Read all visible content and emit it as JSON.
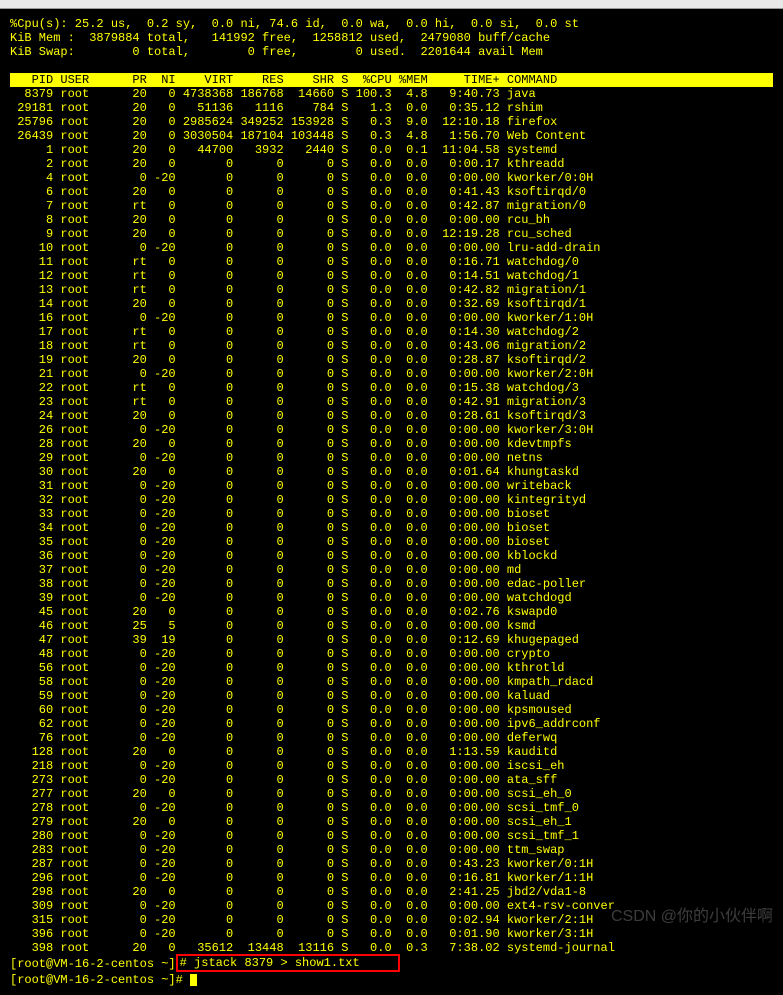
{
  "cpu_line": "%Cpu(s): 25.2 us,  0.2 sy,  0.0 ni, 74.6 id,  0.0 wa,  0.0 hi,  0.0 si,  0.0 st",
  "mem_line": "KiB Mem :  3879884 total,   141992 free,  1258812 used,  2479080 buff/cache",
  "swap_line": "KiB Swap:        0 total,        0 free,        0 used.  2201644 avail Mem",
  "header": "   PID USER      PR  NI    VIRT    RES    SHR S  %CPU %MEM     TIME+ COMMAND            ",
  "processes": [
    {
      "pid": "8379",
      "user": "root",
      "pr": "20",
      "ni": "0",
      "virt": "4738368",
      "res": "186768",
      "shr": "14660",
      "s": "S",
      "cpu": "100.3",
      "mem": "4.8",
      "time": "9:40.73",
      "cmd": "java"
    },
    {
      "pid": "29181",
      "user": "root",
      "pr": "20",
      "ni": "0",
      "virt": "51136",
      "res": "1116",
      "shr": "784",
      "s": "S",
      "cpu": "1.3",
      "mem": "0.0",
      "time": "0:35.12",
      "cmd": "rshim"
    },
    {
      "pid": "25796",
      "user": "root",
      "pr": "20",
      "ni": "0",
      "virt": "2985624",
      "res": "349252",
      "shr": "153928",
      "s": "S",
      "cpu": "0.3",
      "mem": "9.0",
      "time": "12:10.18",
      "cmd": "firefox"
    },
    {
      "pid": "26439",
      "user": "root",
      "pr": "20",
      "ni": "0",
      "virt": "3030504",
      "res": "187104",
      "shr": "103448",
      "s": "S",
      "cpu": "0.3",
      "mem": "4.8",
      "time": "1:56.70",
      "cmd": "Web Content"
    },
    {
      "pid": "1",
      "user": "root",
      "pr": "20",
      "ni": "0",
      "virt": "44700",
      "res": "3932",
      "shr": "2440",
      "s": "S",
      "cpu": "0.0",
      "mem": "0.1",
      "time": "11:04.58",
      "cmd": "systemd"
    },
    {
      "pid": "2",
      "user": "root",
      "pr": "20",
      "ni": "0",
      "virt": "0",
      "res": "0",
      "shr": "0",
      "s": "S",
      "cpu": "0.0",
      "mem": "0.0",
      "time": "0:00.17",
      "cmd": "kthreadd"
    },
    {
      "pid": "4",
      "user": "root",
      "pr": "0",
      "ni": "-20",
      "virt": "0",
      "res": "0",
      "shr": "0",
      "s": "S",
      "cpu": "0.0",
      "mem": "0.0",
      "time": "0:00.00",
      "cmd": "kworker/0:0H"
    },
    {
      "pid": "6",
      "user": "root",
      "pr": "20",
      "ni": "0",
      "virt": "0",
      "res": "0",
      "shr": "0",
      "s": "S",
      "cpu": "0.0",
      "mem": "0.0",
      "time": "0:41.43",
      "cmd": "ksoftirqd/0"
    },
    {
      "pid": "7",
      "user": "root",
      "pr": "rt",
      "ni": "0",
      "virt": "0",
      "res": "0",
      "shr": "0",
      "s": "S",
      "cpu": "0.0",
      "mem": "0.0",
      "time": "0:42.87",
      "cmd": "migration/0"
    },
    {
      "pid": "8",
      "user": "root",
      "pr": "20",
      "ni": "0",
      "virt": "0",
      "res": "0",
      "shr": "0",
      "s": "S",
      "cpu": "0.0",
      "mem": "0.0",
      "time": "0:00.00",
      "cmd": "rcu_bh"
    },
    {
      "pid": "9",
      "user": "root",
      "pr": "20",
      "ni": "0",
      "virt": "0",
      "res": "0",
      "shr": "0",
      "s": "S",
      "cpu": "0.0",
      "mem": "0.0",
      "time": "12:19.28",
      "cmd": "rcu_sched"
    },
    {
      "pid": "10",
      "user": "root",
      "pr": "0",
      "ni": "-20",
      "virt": "0",
      "res": "0",
      "shr": "0",
      "s": "S",
      "cpu": "0.0",
      "mem": "0.0",
      "time": "0:00.00",
      "cmd": "lru-add-drain"
    },
    {
      "pid": "11",
      "user": "root",
      "pr": "rt",
      "ni": "0",
      "virt": "0",
      "res": "0",
      "shr": "0",
      "s": "S",
      "cpu": "0.0",
      "mem": "0.0",
      "time": "0:16.71",
      "cmd": "watchdog/0"
    },
    {
      "pid": "12",
      "user": "root",
      "pr": "rt",
      "ni": "0",
      "virt": "0",
      "res": "0",
      "shr": "0",
      "s": "S",
      "cpu": "0.0",
      "mem": "0.0",
      "time": "0:14.51",
      "cmd": "watchdog/1"
    },
    {
      "pid": "13",
      "user": "root",
      "pr": "rt",
      "ni": "0",
      "virt": "0",
      "res": "0",
      "shr": "0",
      "s": "S",
      "cpu": "0.0",
      "mem": "0.0",
      "time": "0:42.82",
      "cmd": "migration/1"
    },
    {
      "pid": "14",
      "user": "root",
      "pr": "20",
      "ni": "0",
      "virt": "0",
      "res": "0",
      "shr": "0",
      "s": "S",
      "cpu": "0.0",
      "mem": "0.0",
      "time": "0:32.69",
      "cmd": "ksoftirqd/1"
    },
    {
      "pid": "16",
      "user": "root",
      "pr": "0",
      "ni": "-20",
      "virt": "0",
      "res": "0",
      "shr": "0",
      "s": "S",
      "cpu": "0.0",
      "mem": "0.0",
      "time": "0:00.00",
      "cmd": "kworker/1:0H"
    },
    {
      "pid": "17",
      "user": "root",
      "pr": "rt",
      "ni": "0",
      "virt": "0",
      "res": "0",
      "shr": "0",
      "s": "S",
      "cpu": "0.0",
      "mem": "0.0",
      "time": "0:14.30",
      "cmd": "watchdog/2"
    },
    {
      "pid": "18",
      "user": "root",
      "pr": "rt",
      "ni": "0",
      "virt": "0",
      "res": "0",
      "shr": "0",
      "s": "S",
      "cpu": "0.0",
      "mem": "0.0",
      "time": "0:43.06",
      "cmd": "migration/2"
    },
    {
      "pid": "19",
      "user": "root",
      "pr": "20",
      "ni": "0",
      "virt": "0",
      "res": "0",
      "shr": "0",
      "s": "S",
      "cpu": "0.0",
      "mem": "0.0",
      "time": "0:28.87",
      "cmd": "ksoftirqd/2"
    },
    {
      "pid": "21",
      "user": "root",
      "pr": "0",
      "ni": "-20",
      "virt": "0",
      "res": "0",
      "shr": "0",
      "s": "S",
      "cpu": "0.0",
      "mem": "0.0",
      "time": "0:00.00",
      "cmd": "kworker/2:0H"
    },
    {
      "pid": "22",
      "user": "root",
      "pr": "rt",
      "ni": "0",
      "virt": "0",
      "res": "0",
      "shr": "0",
      "s": "S",
      "cpu": "0.0",
      "mem": "0.0",
      "time": "0:15.38",
      "cmd": "watchdog/3"
    },
    {
      "pid": "23",
      "user": "root",
      "pr": "rt",
      "ni": "0",
      "virt": "0",
      "res": "0",
      "shr": "0",
      "s": "S",
      "cpu": "0.0",
      "mem": "0.0",
      "time": "0:42.91",
      "cmd": "migration/3"
    },
    {
      "pid": "24",
      "user": "root",
      "pr": "20",
      "ni": "0",
      "virt": "0",
      "res": "0",
      "shr": "0",
      "s": "S",
      "cpu": "0.0",
      "mem": "0.0",
      "time": "0:28.61",
      "cmd": "ksoftirqd/3"
    },
    {
      "pid": "26",
      "user": "root",
      "pr": "0",
      "ni": "-20",
      "virt": "0",
      "res": "0",
      "shr": "0",
      "s": "S",
      "cpu": "0.0",
      "mem": "0.0",
      "time": "0:00.00",
      "cmd": "kworker/3:0H"
    },
    {
      "pid": "28",
      "user": "root",
      "pr": "20",
      "ni": "0",
      "virt": "0",
      "res": "0",
      "shr": "0",
      "s": "S",
      "cpu": "0.0",
      "mem": "0.0",
      "time": "0:00.00",
      "cmd": "kdevtmpfs"
    },
    {
      "pid": "29",
      "user": "root",
      "pr": "0",
      "ni": "-20",
      "virt": "0",
      "res": "0",
      "shr": "0",
      "s": "S",
      "cpu": "0.0",
      "mem": "0.0",
      "time": "0:00.00",
      "cmd": "netns"
    },
    {
      "pid": "30",
      "user": "root",
      "pr": "20",
      "ni": "0",
      "virt": "0",
      "res": "0",
      "shr": "0",
      "s": "S",
      "cpu": "0.0",
      "mem": "0.0",
      "time": "0:01.64",
      "cmd": "khungtaskd"
    },
    {
      "pid": "31",
      "user": "root",
      "pr": "0",
      "ni": "-20",
      "virt": "0",
      "res": "0",
      "shr": "0",
      "s": "S",
      "cpu": "0.0",
      "mem": "0.0",
      "time": "0:00.00",
      "cmd": "writeback"
    },
    {
      "pid": "32",
      "user": "root",
      "pr": "0",
      "ni": "-20",
      "virt": "0",
      "res": "0",
      "shr": "0",
      "s": "S",
      "cpu": "0.0",
      "mem": "0.0",
      "time": "0:00.00",
      "cmd": "kintegrityd"
    },
    {
      "pid": "33",
      "user": "root",
      "pr": "0",
      "ni": "-20",
      "virt": "0",
      "res": "0",
      "shr": "0",
      "s": "S",
      "cpu": "0.0",
      "mem": "0.0",
      "time": "0:00.00",
      "cmd": "bioset"
    },
    {
      "pid": "34",
      "user": "root",
      "pr": "0",
      "ni": "-20",
      "virt": "0",
      "res": "0",
      "shr": "0",
      "s": "S",
      "cpu": "0.0",
      "mem": "0.0",
      "time": "0:00.00",
      "cmd": "bioset"
    },
    {
      "pid": "35",
      "user": "root",
      "pr": "0",
      "ni": "-20",
      "virt": "0",
      "res": "0",
      "shr": "0",
      "s": "S",
      "cpu": "0.0",
      "mem": "0.0",
      "time": "0:00.00",
      "cmd": "bioset"
    },
    {
      "pid": "36",
      "user": "root",
      "pr": "0",
      "ni": "-20",
      "virt": "0",
      "res": "0",
      "shr": "0",
      "s": "S",
      "cpu": "0.0",
      "mem": "0.0",
      "time": "0:00.00",
      "cmd": "kblockd"
    },
    {
      "pid": "37",
      "user": "root",
      "pr": "0",
      "ni": "-20",
      "virt": "0",
      "res": "0",
      "shr": "0",
      "s": "S",
      "cpu": "0.0",
      "mem": "0.0",
      "time": "0:00.00",
      "cmd": "md"
    },
    {
      "pid": "38",
      "user": "root",
      "pr": "0",
      "ni": "-20",
      "virt": "0",
      "res": "0",
      "shr": "0",
      "s": "S",
      "cpu": "0.0",
      "mem": "0.0",
      "time": "0:00.00",
      "cmd": "edac-poller"
    },
    {
      "pid": "39",
      "user": "root",
      "pr": "0",
      "ni": "-20",
      "virt": "0",
      "res": "0",
      "shr": "0",
      "s": "S",
      "cpu": "0.0",
      "mem": "0.0",
      "time": "0:00.00",
      "cmd": "watchdogd"
    },
    {
      "pid": "45",
      "user": "root",
      "pr": "20",
      "ni": "0",
      "virt": "0",
      "res": "0",
      "shr": "0",
      "s": "S",
      "cpu": "0.0",
      "mem": "0.0",
      "time": "0:02.76",
      "cmd": "kswapd0"
    },
    {
      "pid": "46",
      "user": "root",
      "pr": "25",
      "ni": "5",
      "virt": "0",
      "res": "0",
      "shr": "0",
      "s": "S",
      "cpu": "0.0",
      "mem": "0.0",
      "time": "0:00.00",
      "cmd": "ksmd"
    },
    {
      "pid": "47",
      "user": "root",
      "pr": "39",
      "ni": "19",
      "virt": "0",
      "res": "0",
      "shr": "0",
      "s": "S",
      "cpu": "0.0",
      "mem": "0.0",
      "time": "0:12.69",
      "cmd": "khugepaged"
    },
    {
      "pid": "48",
      "user": "root",
      "pr": "0",
      "ni": "-20",
      "virt": "0",
      "res": "0",
      "shr": "0",
      "s": "S",
      "cpu": "0.0",
      "mem": "0.0",
      "time": "0:00.00",
      "cmd": "crypto"
    },
    {
      "pid": "56",
      "user": "root",
      "pr": "0",
      "ni": "-20",
      "virt": "0",
      "res": "0",
      "shr": "0",
      "s": "S",
      "cpu": "0.0",
      "mem": "0.0",
      "time": "0:00.00",
      "cmd": "kthrotld"
    },
    {
      "pid": "58",
      "user": "root",
      "pr": "0",
      "ni": "-20",
      "virt": "0",
      "res": "0",
      "shr": "0",
      "s": "S",
      "cpu": "0.0",
      "mem": "0.0",
      "time": "0:00.00",
      "cmd": "kmpath_rdacd"
    },
    {
      "pid": "59",
      "user": "root",
      "pr": "0",
      "ni": "-20",
      "virt": "0",
      "res": "0",
      "shr": "0",
      "s": "S",
      "cpu": "0.0",
      "mem": "0.0",
      "time": "0:00.00",
      "cmd": "kaluad"
    },
    {
      "pid": "60",
      "user": "root",
      "pr": "0",
      "ni": "-20",
      "virt": "0",
      "res": "0",
      "shr": "0",
      "s": "S",
      "cpu": "0.0",
      "mem": "0.0",
      "time": "0:00.00",
      "cmd": "kpsmoused"
    },
    {
      "pid": "62",
      "user": "root",
      "pr": "0",
      "ni": "-20",
      "virt": "0",
      "res": "0",
      "shr": "0",
      "s": "S",
      "cpu": "0.0",
      "mem": "0.0",
      "time": "0:00.00",
      "cmd": "ipv6_addrconf"
    },
    {
      "pid": "76",
      "user": "root",
      "pr": "0",
      "ni": "-20",
      "virt": "0",
      "res": "0",
      "shr": "0",
      "s": "S",
      "cpu": "0.0",
      "mem": "0.0",
      "time": "0:00.00",
      "cmd": "deferwq"
    },
    {
      "pid": "128",
      "user": "root",
      "pr": "20",
      "ni": "0",
      "virt": "0",
      "res": "0",
      "shr": "0",
      "s": "S",
      "cpu": "0.0",
      "mem": "0.0",
      "time": "1:13.59",
      "cmd": "kauditd"
    },
    {
      "pid": "218",
      "user": "root",
      "pr": "0",
      "ni": "-20",
      "virt": "0",
      "res": "0",
      "shr": "0",
      "s": "S",
      "cpu": "0.0",
      "mem": "0.0",
      "time": "0:00.00",
      "cmd": "iscsi_eh"
    },
    {
      "pid": "273",
      "user": "root",
      "pr": "0",
      "ni": "-20",
      "virt": "0",
      "res": "0",
      "shr": "0",
      "s": "S",
      "cpu": "0.0",
      "mem": "0.0",
      "time": "0:00.00",
      "cmd": "ata_sff"
    },
    {
      "pid": "277",
      "user": "root",
      "pr": "20",
      "ni": "0",
      "virt": "0",
      "res": "0",
      "shr": "0",
      "s": "S",
      "cpu": "0.0",
      "mem": "0.0",
      "time": "0:00.00",
      "cmd": "scsi_eh_0"
    },
    {
      "pid": "278",
      "user": "root",
      "pr": "0",
      "ni": "-20",
      "virt": "0",
      "res": "0",
      "shr": "0",
      "s": "S",
      "cpu": "0.0",
      "mem": "0.0",
      "time": "0:00.00",
      "cmd": "scsi_tmf_0"
    },
    {
      "pid": "279",
      "user": "root",
      "pr": "20",
      "ni": "0",
      "virt": "0",
      "res": "0",
      "shr": "0",
      "s": "S",
      "cpu": "0.0",
      "mem": "0.0",
      "time": "0:00.00",
      "cmd": "scsi_eh_1"
    },
    {
      "pid": "280",
      "user": "root",
      "pr": "0",
      "ni": "-20",
      "virt": "0",
      "res": "0",
      "shr": "0",
      "s": "S",
      "cpu": "0.0",
      "mem": "0.0",
      "time": "0:00.00",
      "cmd": "scsi_tmf_1"
    },
    {
      "pid": "283",
      "user": "root",
      "pr": "0",
      "ni": "-20",
      "virt": "0",
      "res": "0",
      "shr": "0",
      "s": "S",
      "cpu": "0.0",
      "mem": "0.0",
      "time": "0:00.00",
      "cmd": "ttm_swap"
    },
    {
      "pid": "287",
      "user": "root",
      "pr": "0",
      "ni": "-20",
      "virt": "0",
      "res": "0",
      "shr": "0",
      "s": "S",
      "cpu": "0.0",
      "mem": "0.0",
      "time": "0:43.23",
      "cmd": "kworker/0:1H"
    },
    {
      "pid": "296",
      "user": "root",
      "pr": "0",
      "ni": "-20",
      "virt": "0",
      "res": "0",
      "shr": "0",
      "s": "S",
      "cpu": "0.0",
      "mem": "0.0",
      "time": "0:16.81",
      "cmd": "kworker/1:1H"
    },
    {
      "pid": "298",
      "user": "root",
      "pr": "20",
      "ni": "0",
      "virt": "0",
      "res": "0",
      "shr": "0",
      "s": "S",
      "cpu": "0.0",
      "mem": "0.0",
      "time": "2:41.25",
      "cmd": "jbd2/vda1-8"
    },
    {
      "pid": "309",
      "user": "root",
      "pr": "0",
      "ni": "-20",
      "virt": "0",
      "res": "0",
      "shr": "0",
      "s": "S",
      "cpu": "0.0",
      "mem": "0.0",
      "time": "0:00.00",
      "cmd": "ext4-rsv-conver"
    },
    {
      "pid": "315",
      "user": "root",
      "pr": "0",
      "ni": "-20",
      "virt": "0",
      "res": "0",
      "shr": "0",
      "s": "S",
      "cpu": "0.0",
      "mem": "0.0",
      "time": "0:02.94",
      "cmd": "kworker/2:1H"
    },
    {
      "pid": "396",
      "user": "root",
      "pr": "0",
      "ni": "-20",
      "virt": "0",
      "res": "0",
      "shr": "0",
      "s": "S",
      "cpu": "0.0",
      "mem": "0.0",
      "time": "0:01.90",
      "cmd": "kworker/3:1H"
    },
    {
      "pid": "398",
      "user": "root",
      "pr": "20",
      "ni": "0",
      "virt": "35612",
      "res": "13448",
      "shr": "13116",
      "s": "S",
      "cpu": "0.0",
      "mem": "0.3",
      "time": "7:38.02",
      "cmd": "systemd-journal"
    }
  ],
  "prompt1_prefix": "[root@VM-16-2-centos ~]",
  "prompt1_cmd": "# jstack 8379 > show1.txt",
  "prompt2_prefix": "[root@VM-16-2-centos ~]",
  "prompt2_hash": "# ",
  "watermark": "CSDN @你的小伙伴啊"
}
